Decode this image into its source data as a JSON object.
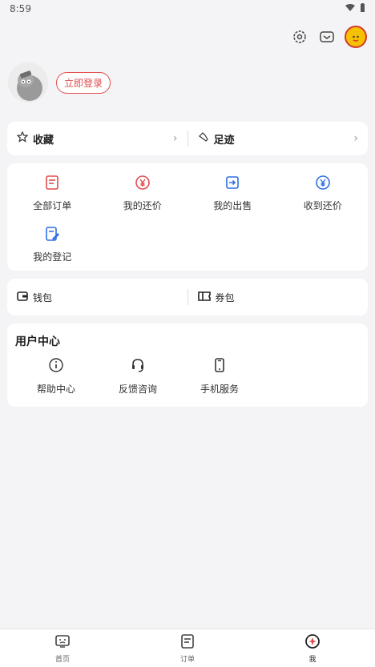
{
  "status_bar": {
    "time": "8:59"
  },
  "profile": {
    "login_label": "立即登录"
  },
  "favorites": [
    {
      "label": "收藏",
      "icon": "star-icon"
    },
    {
      "label": "足迹",
      "icon": "footprint-icon"
    }
  ],
  "orders": {
    "items": [
      {
        "label": "全部订单",
        "icon": "order-list-icon",
        "color": "#e24b4b"
      },
      {
        "label": "我的还价",
        "icon": "yuan-icon",
        "color": "#e24b4b"
      },
      {
        "label": "我的出售",
        "icon": "sell-icon",
        "color": "#2f6fe4"
      },
      {
        "label": "收到还价",
        "icon": "yuan-icon",
        "color": "#2f6fe4"
      },
      {
        "label": "我的登记",
        "icon": "register-icon",
        "color": "#2f6fe4"
      }
    ]
  },
  "wallet": [
    {
      "label": "钱包",
      "icon": "wallet-icon"
    },
    {
      "label": "券包",
      "icon": "coupon-icon"
    }
  ],
  "user_center": {
    "title": "用户中心",
    "items": [
      {
        "label": "帮助中心",
        "icon": "info-icon"
      },
      {
        "label": "反馈咨询",
        "icon": "headset-icon"
      },
      {
        "label": "手机服务",
        "icon": "phone-icon"
      }
    ]
  },
  "bottom_nav": [
    {
      "label": "首页",
      "icon": "home-icon"
    },
    {
      "label": "订单",
      "icon": "orders-icon"
    },
    {
      "label": "我",
      "icon": "me-icon",
      "active": true
    }
  ]
}
